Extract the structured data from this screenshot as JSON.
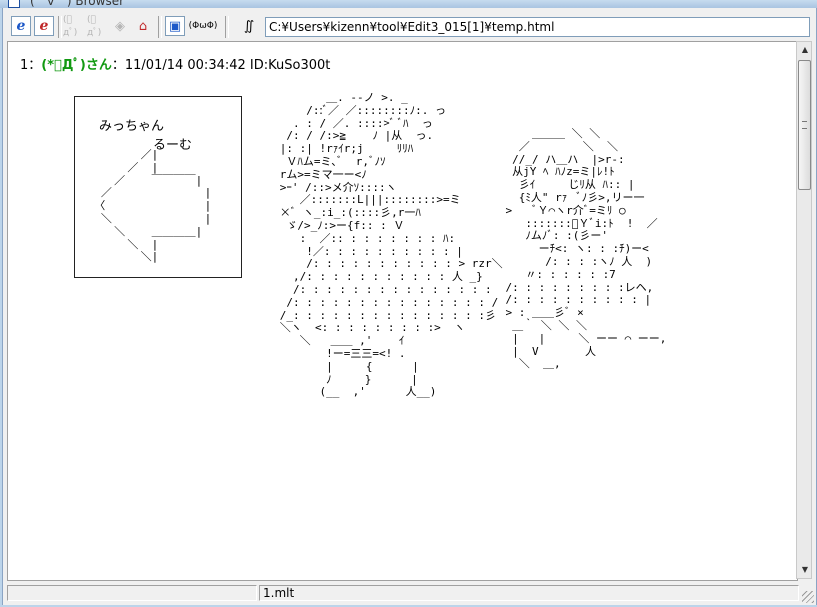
{
  "window": {
    "title": "(゜∀゜) Browser"
  },
  "toolbar": {
    "buttons": [
      {
        "name": "ie-blue-button",
        "glyph": "e"
      },
      {
        "name": "ie-red-button",
        "glyph": "e"
      },
      {
        "name": "prev-aa-button",
        "glyph": "(ﾟдﾟ)"
      },
      {
        "name": "next-aa-button",
        "glyph": "(ﾟдﾟ)"
      },
      {
        "name": "nav-circle-button",
        "glyph": "◈"
      },
      {
        "name": "home-button",
        "glyph": "⌂"
      },
      {
        "name": "window-button",
        "glyph": "▣"
      },
      {
        "name": "monar-face-button",
        "glyph": "(ΦωΦ)"
      },
      {
        "name": "aa-settings-button",
        "glyph": "∬"
      }
    ],
    "address": "C:¥Users¥kizenn¥tool¥Edit3_015[1]¥temp.html"
  },
  "post": {
    "number": "1",
    "separator": "：",
    "name": "(*ﾟДﾟ)さん",
    "date_sep": "：",
    "date": "11/01/14 00:34:42",
    "id": "ID:KuSo300t"
  },
  "sign": {
    "text1": "みっちゃん",
    "text2": "るーむ"
  },
  "aa_art": {
    "sign_arrow": "         ／|\n       ／  |\n     ／    ￣￣￣￣|\n   ／              |\n  〈               |\n   ＼              |\n     ＼    ＿＿＿＿|\n       ＼  |\n         ＼|",
    "characters": "             ＿. -‐ノ >. _\n          /::ﾞ／ ／::::::::ﾉ:. っ\n        . : / ／. ::::>ﾞ ﾞﾊ  っ\n       /: / /:>≧    ﾉ |从  っ.\n      |: :| !rｧｲr;j     ﾘﾘﾊ\n       Ｖﾊム=ミ､ﾞ  r,ﾞﾉｿ\n      rム>=ミマ一ー<ﾉ\n      >ｰ' /::>メ介ｿ::::ヽ\n         ／:::::::L|||::::::::>=ミ\n      ×ﾞ ヽ_:i_:(::::彡,r一ﾊ\n       ゞ/>_ﾉ:>ー{f:: : Ｖ\n         :  ／:: : : : : : : : ﾊ:\n          !／: : : : : : : : : : |\n          /: : : : : : : : : : : > rzr＼\n        ,/: : : : : : : : : : : 人 _}\n        /: : : : : : : : : : : : : : :\n       /: : : : : : : : : : : : : : : /\n      /_: : : : : : : : : : : : : : :彡\n      ＼ヽ  <: : : : : : : : :>  ヽ\n         ＼   ＿＿ ,'    ｲ\n             !ー=三三=<! .\n             |     {      |\n             ﾉ     }      |\n            (__  ,'      人__)",
    "characters2": "                ＿＿＿ ＼ ＼\n              ／        ＼  ＼\n             //_/ ハ＿ハ  |>r-:\n             从jY ﾍ ﾊﾉz=ミ|ﾚ!ﾄ\n              彡ｲ     じﾘ从 ﾊ:: |\n              {ﾐ人\" rｧ  ﾞﾉ彡>,リー一\n            >   ﾞＹ⌒ヽr介ﾞ=ミﾘ ○\n               :::::::ﾞＹﾞi:ﾄ  !  ／\n               ﾉムﾉﾞ: :(彡ー'\n                 ーﾁ<: ヽ: : :ﾁ)ー<\n                  /: : : :ヽﾉ 人  )\n               〃: : : : : :7\n            /: : : : : : : : :レヘ,\n            /: : : : : : : : : : |\n            > : ＿＿彡ﾞ ×\n             ＿｀ ＼ ＼ ＼\n             |   |     ＼ ーー ⌒ ーー,\n             |  V       人\n              ＼  ＿,"
  },
  "status": {
    "left": "",
    "file": "1.mlt",
    "right": ""
  }
}
